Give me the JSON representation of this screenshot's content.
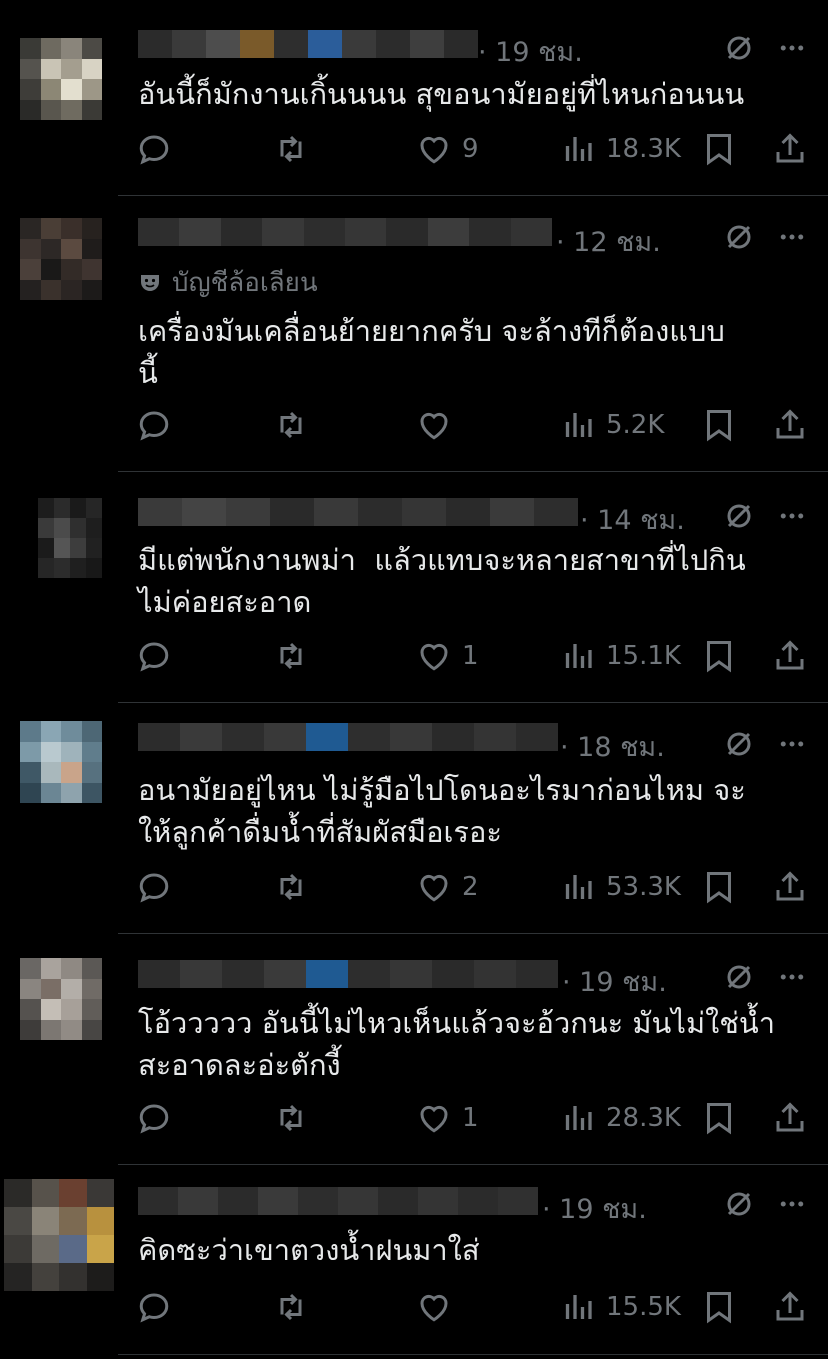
{
  "replies": [
    {
      "time": "· 19 ชม.",
      "badge": "",
      "text": "อันนี้ก็มักงานเกิ้นนนน สุขอนามัยอยู่ที่ไหนก่อนนน",
      "likes": "9",
      "views": "18.3K"
    },
    {
      "time": "· 12 ชม.",
      "badge": "บัญชีล้อเลียน",
      "text": "เครื่องมันเคลื่อนย้ายยากครับ จะล้างทีก็ต้องแบบ\nนี้",
      "likes": "",
      "views": "5.2K"
    },
    {
      "time": "· 14 ชม.",
      "badge": "",
      "text": "มีแต่พนักงานพม่า  แล้วแทบจะหลายสาขาที่ไปกิน\nไม่ค่อยสะอาด",
      "likes": "1",
      "views": "15.1K"
    },
    {
      "time": "· 18 ชม.",
      "badge": "",
      "text": "อนามัยอยู่ไหน ไม่รู้มือไปโดนอะไรมาก่อนไหม จะ\nให้ลูกค้าดื่มน้ำที่สัมผัสมือเรอะ",
      "likes": "2",
      "views": "53.3K"
    },
    {
      "time": "· 19 ชม.",
      "badge": "",
      "text": "โอ้ววววว อันนี้ไม่ไหวเห็นแล้วจะอ้วกนะ มันไม่ใช่น้ำ\nสะอาดละอ่ะตักงี้",
      "likes": "1",
      "views": "28.3K"
    },
    {
      "time": "· 19 ชม.",
      "badge": "",
      "text": "คิดซะว่าเขาตวงน้ำฝนมาใส่",
      "likes": "",
      "views": "15.5K"
    }
  ],
  "icons": {
    "reply": "reply-icon",
    "retweet": "retweet-icon",
    "like": "heart-icon",
    "views": "views-icon",
    "bookmark": "bookmark-icon",
    "share": "share-icon",
    "grok": "grok-icon",
    "more": "more-icon",
    "parody": "parody-mask-icon"
  },
  "colors": {
    "background": "#000000",
    "text": "#e7e9ea",
    "muted": "#71767b",
    "divider": "#2f3336"
  }
}
